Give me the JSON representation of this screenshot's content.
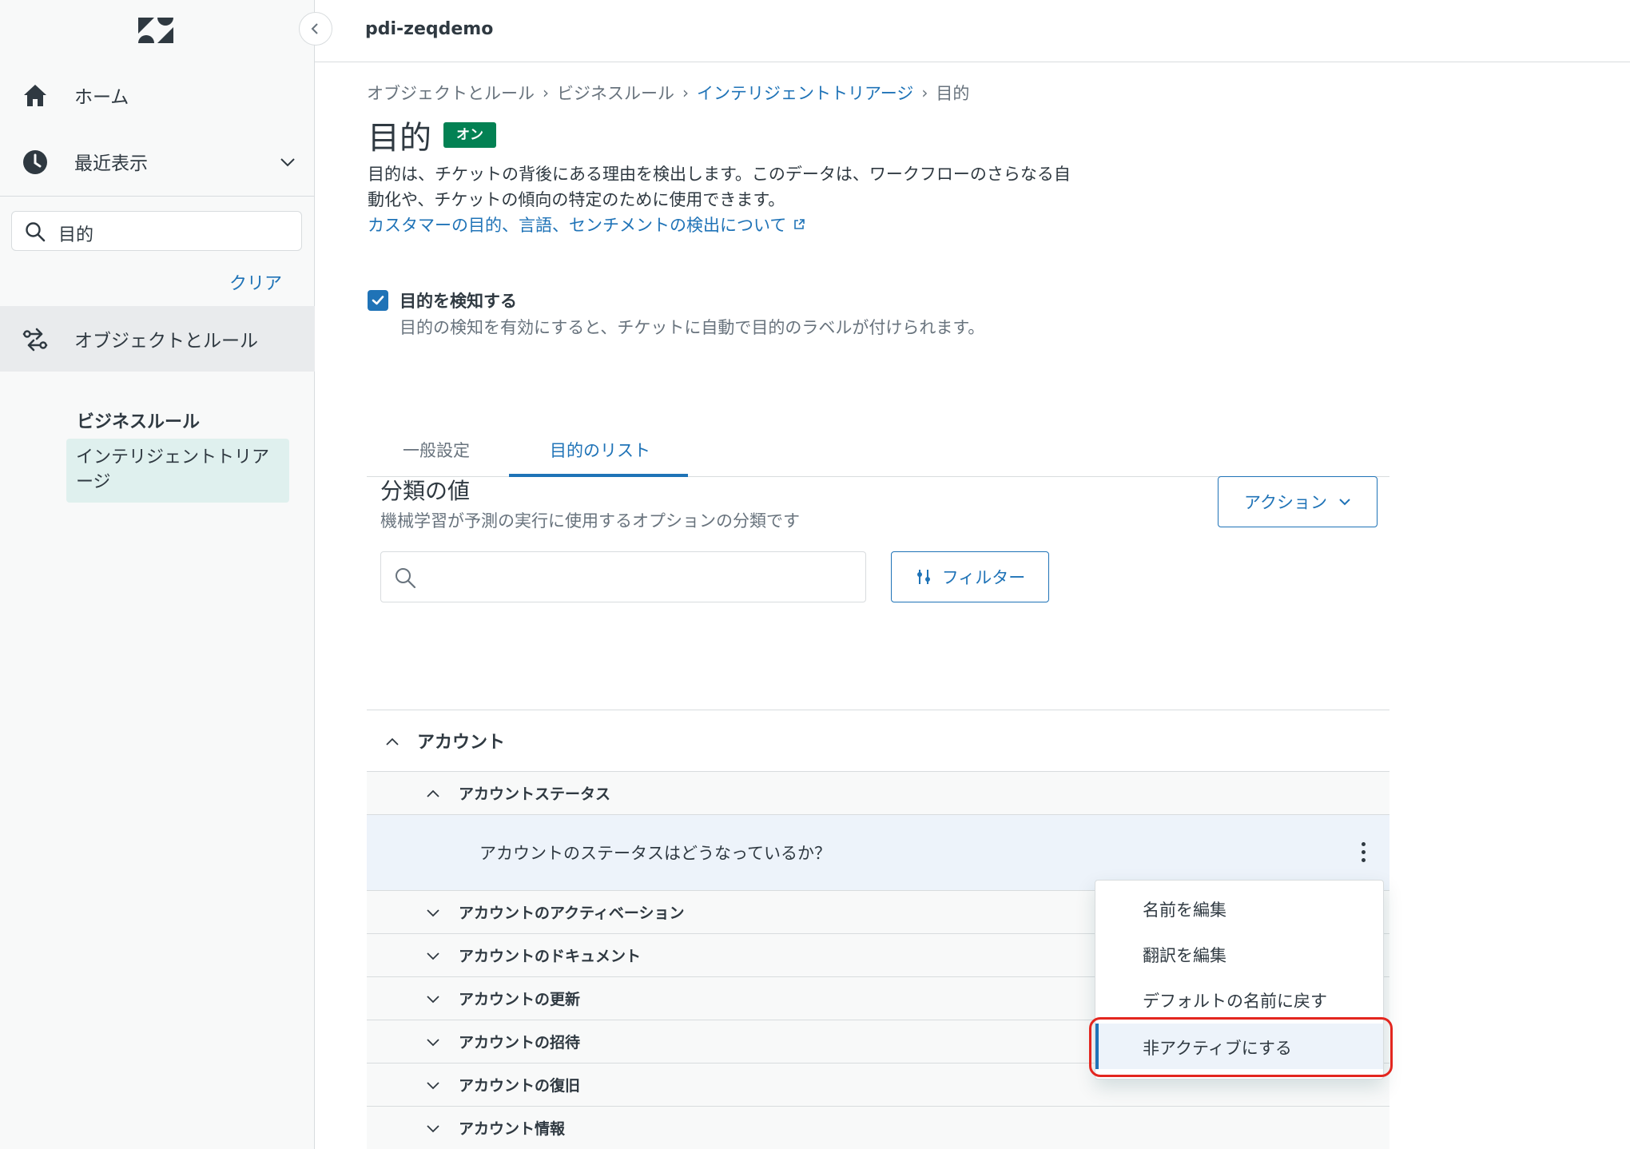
{
  "app": {
    "account_name": "pdi-zeqdemo"
  },
  "sidebar": {
    "home_label": "ホーム",
    "recent_label": "最近表示",
    "search_value": "目的",
    "clear_label": "クリア",
    "objects_label": "オブジェクトとルール",
    "section_heading": "ビジネスルール",
    "active_item": "インテリジェントトリアージ"
  },
  "breadcrumb": [
    {
      "label": "オブジェクトとルール"
    },
    {
      "label": "ビジネスルール"
    },
    {
      "label": "インテリジェントトリアージ"
    },
    {
      "label": "目的"
    }
  ],
  "page": {
    "title": "目的",
    "status_badge": "オン",
    "description": "目的は、チケットの背後にある理由を検出します。このデータは、ワークフローのさらなる自動化や、チケットの傾向の特定のために使用できます。",
    "learn_more": "カスタマーの目的、言語、センチメントの検出について"
  },
  "detect": {
    "checked": true,
    "label": "目的を検知する",
    "hint": "目的の検知を有効にすると、チケットに自動で目的のラベルが付けられます。"
  },
  "tabs": {
    "general": "一般設定",
    "list": "目的のリスト"
  },
  "values_section": {
    "title": "分類の値",
    "subtitle": "機械学習が予測の実行に使用するオプションの分類です",
    "actions_label": "アクション",
    "search_placeholder": "",
    "filter_label": "フィルター"
  },
  "tree": {
    "top_label": "アカウント",
    "expanded_label": "アカウントステータス",
    "leaf_label": "アカウントのステータスはどうなっているか？",
    "collapsed": [
      "アカウントのアクティベーション",
      "アカウントのドキュメント",
      "アカウントの更新",
      "アカウントの招待",
      "アカウントの復旧",
      "アカウント情報"
    ]
  },
  "menu": {
    "items": [
      "名前を編集",
      "翻訳を編集",
      "デフォルトの名前に戻す",
      "非アクティブにする"
    ],
    "highlighted_index": 3
  },
  "colors": {
    "accent": "#1f73b7",
    "badge_green": "#038153",
    "highlight_red": "#e3261f",
    "sidebar_bg": "#f8f9f9"
  },
  "icons": [
    "zendesk-logo",
    "chevron-left-icon",
    "home-icon",
    "clock-icon",
    "chevron-down-icon",
    "search-icon",
    "objects-rules-icon",
    "external-link-icon",
    "check-icon",
    "filter-icon",
    "chevron-up-icon",
    "kebab-icon"
  ]
}
